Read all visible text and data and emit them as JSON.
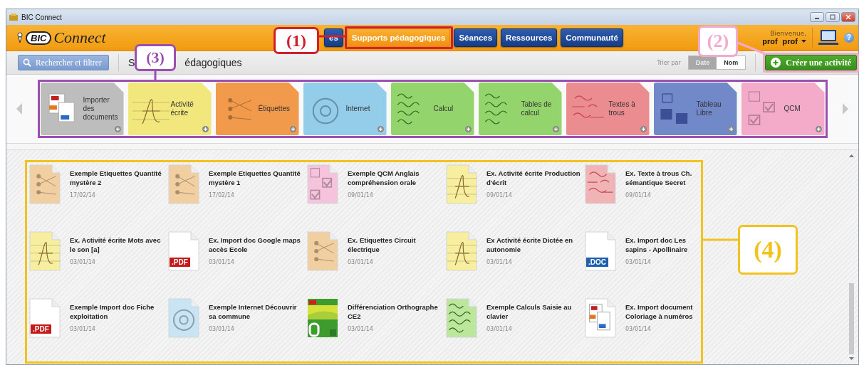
{
  "window": {
    "title": "BIC Connect"
  },
  "logo": {
    "brand": "BIC",
    "name": "Connect"
  },
  "nav_tabs": [
    {
      "label": "es",
      "selected": false
    },
    {
      "label": "Supports pédagogiques",
      "selected": true
    },
    {
      "label": "Séances",
      "selected": false
    },
    {
      "label": "Ressources",
      "selected": false
    },
    {
      "label": "Communauté",
      "selected": false
    }
  ],
  "user": {
    "greeting": "Bienvenue,",
    "first_name": "prof",
    "last_name": "prof"
  },
  "help_icon": "?",
  "toolbar": {
    "search_button": "Rechercher et filtrer",
    "section_title_start": "S",
    "section_title_end": "édagogiques",
    "sort_label": "Trier par",
    "sort_options": [
      {
        "label": "Date",
        "selected": true
      },
      {
        "label": "Nom",
        "selected": false
      }
    ],
    "create_button": "Créer une activité"
  },
  "categories": [
    {
      "label": "Importer des documents",
      "kind": "import",
      "color": "#bdbdbd"
    },
    {
      "label": "Activité écrite",
      "kind": "ecrite",
      "color": "#f2e77c"
    },
    {
      "label": "Étiquettes",
      "kind": "etiquettes",
      "color": "#f29a4c"
    },
    {
      "label": "Internet",
      "kind": "internet",
      "color": "#93cdea"
    },
    {
      "label": "Calcul",
      "kind": "calcul",
      "color": "#93d46c"
    },
    {
      "label": "Tables de calcul",
      "kind": "tables",
      "color": "#93d46c"
    },
    {
      "label": "Textes à trous",
      "kind": "trous",
      "color": "#eb8c90"
    },
    {
      "label": "Tableau Libre",
      "kind": "tableau",
      "color": "#7189c9"
    },
    {
      "label": "QCM",
      "kind": "qcm",
      "color": "#f4abca"
    }
  ],
  "items": [
    {
      "title": "Exemple Etiquettes Quantité mystère 2",
      "date": "17/02/14",
      "kind": "etiquettes"
    },
    {
      "title": "Exemple Etiquettes  Quantité mystère 1",
      "date": "17/02/14",
      "kind": "etiquettes"
    },
    {
      "title": "Exemple QCM Anglais compréhension orale",
      "date": "09/01/14",
      "kind": "qcm"
    },
    {
      "title": "Ex. Activité écrite Production d'écrit",
      "date": "09/01/14",
      "kind": "ecrite"
    },
    {
      "title": "Ex. Texte à trous  Ch. sémantique Secret",
      "date": "09/01/14",
      "kind": "trous"
    },
    {
      "title": "Ex. Activité écrite Mots avec le son [a]",
      "date": "03/01/14",
      "kind": "ecrite"
    },
    {
      "title": "Ex. Import doc Google maps accès Ecole",
      "date": "03/01/14",
      "kind": "pdf",
      "badge": ".PDF"
    },
    {
      "title": "Ex. Etiquettes Circuit électrique",
      "date": "03/01/14",
      "kind": "etiquettes"
    },
    {
      "title": "Ex  Activité écrite  Dictée en autonomie",
      "date": "03/01/14",
      "kind": "ecrite"
    },
    {
      "title": "Ex. Import doc Les sapins - Apollinaire",
      "date": "03/01/14",
      "kind": "doc",
      "badge": ".DOC"
    },
    {
      "title": "Exemple Import doc Fiche exploitation",
      "date": "03/01/14",
      "kind": "pdf",
      "badge": ".PDF"
    },
    {
      "title": "Exemple Internet Découvrir sa commune",
      "date": "03/01/14",
      "kind": "internet"
    },
    {
      "title": "Différenciation Orthographe CE2",
      "date": "03/01/14",
      "kind": "book"
    },
    {
      "title": "Exemple Calculs Saisie au clavier",
      "date": "03/01/14",
      "kind": "calcul"
    },
    {
      "title": "Ex. Import document Coloriage à numéros",
      "date": "03/01/14",
      "kind": "import"
    }
  ],
  "callouts": [
    {
      "label": "(1)",
      "color": "#d21f2e"
    },
    {
      "label": "(2)",
      "color": "#f2aacb"
    },
    {
      "label": "(3)",
      "color": "#9b4fb0"
    },
    {
      "label": "(4)",
      "color": "#f2c21e"
    }
  ]
}
